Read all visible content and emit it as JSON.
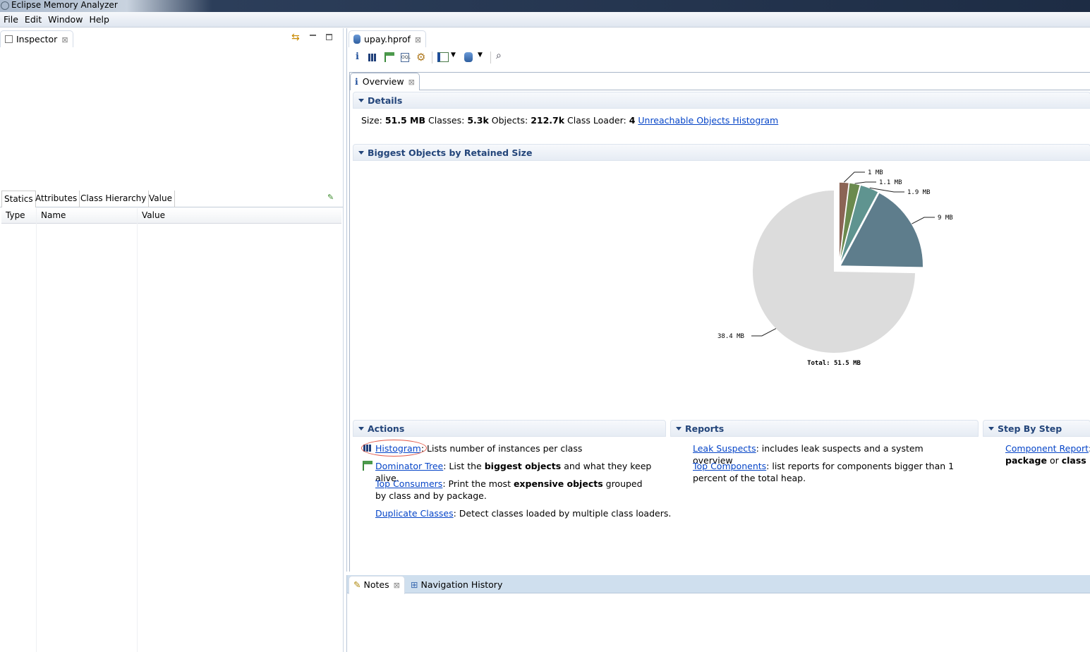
{
  "window": {
    "title": "Eclipse Memory Analyzer"
  },
  "menu": [
    "File",
    "Edit",
    "Window",
    "Help"
  ],
  "inspector": {
    "tab_label": "Inspector",
    "subtabs": [
      "Statics",
      "Attributes",
      "Class Hierarchy",
      "Value"
    ],
    "columns": [
      "Type",
      "Name",
      "Value"
    ]
  },
  "editor": {
    "tab_label": "upay.hprof",
    "toolbar_icons": [
      "info-icon",
      "histogram-icon",
      "dominator-tree-icon",
      "oql-icon",
      "gear-icon",
      "query-browser-icon",
      "heap-dump-overview-icon",
      "search-icon"
    ],
    "overview_tab": "Overview"
  },
  "details": {
    "title": "Details",
    "size_label": "Size:",
    "size": "51.5 MB",
    "classes_label": "Classes:",
    "classes": "5.3k",
    "objects_label": "Objects:",
    "objects": "212.7k",
    "loader_label": "Class Loader:",
    "loader": "4",
    "link": "Unreachable Objects Histogram"
  },
  "biggest": {
    "title": "Biggest Objects by Retained Size"
  },
  "chart_data": {
    "type": "pie",
    "values": [
      1,
      1.1,
      1.9,
      9,
      38.4
    ],
    "labels": [
      "1 MB",
      "1.1 MB",
      "1.9 MB",
      "9 MB",
      "38.4 MB"
    ],
    "colors": [
      "#8b6455",
      "#6b8a4e",
      "#5f9490",
      "#5e7d8c",
      "#dcdcdc"
    ],
    "total_label": "Total: 51.5 MB"
  },
  "actions": {
    "title": "Actions",
    "items": [
      {
        "link": "Histogram",
        "parts": [
          ": Lists number of instances per class"
        ]
      },
      {
        "link": "Dominator Tree",
        "pre": ": List the ",
        "bold": "biggest objects",
        "post": " and what they keep alive."
      },
      {
        "link": "Top Consumers",
        "pre": ": Print the most ",
        "bold": "expensive objects",
        "post": " grouped by class and by package."
      },
      {
        "link": "Duplicate Classes",
        "pre": ": Detect classes loaded by multiple class loaders."
      }
    ]
  },
  "reports": {
    "title": "Reports",
    "items": [
      {
        "link": "Leak Suspects",
        "text": ": includes leak suspects and a system overview"
      },
      {
        "link": "Top Components",
        "text": ": list reports for components bigger than 1 percent of the total heap."
      }
    ]
  },
  "stepbystep": {
    "title": "Step By Step",
    "link": "Component Report",
    "text": ":",
    "b1": "package",
    "mid": " or ",
    "b2": "class loa"
  },
  "bottom": {
    "tabs": [
      "Notes",
      "Navigation History"
    ]
  }
}
